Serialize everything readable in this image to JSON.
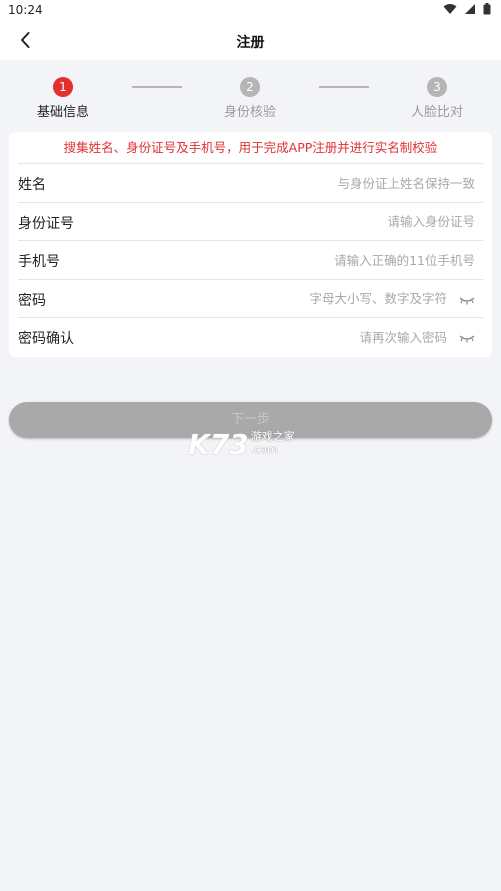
{
  "status_bar": {
    "time": "10:24"
  },
  "header": {
    "title": "注册"
  },
  "steps": [
    {
      "number": "1",
      "label": "基础信息",
      "active": true
    },
    {
      "number": "2",
      "label": "身份核验",
      "active": false
    },
    {
      "number": "3",
      "label": "人脸比对",
      "active": false
    }
  ],
  "form": {
    "notice": "搜集姓名、身份证号及手机号，用于完成APP注册并进行实名制校验",
    "fields": [
      {
        "label": "姓名",
        "placeholder": "与身份证上姓名保持一致",
        "value": ""
      },
      {
        "label": "身份证号",
        "placeholder": "请输入身份证号",
        "value": ""
      },
      {
        "label": "手机号",
        "placeholder": "请输入正确的11位手机号",
        "value": ""
      },
      {
        "label": "密码",
        "placeholder": "字母大小写、数字及字符",
        "value": ""
      },
      {
        "label": "密码确认",
        "placeholder": "请再次输入密码",
        "value": ""
      }
    ]
  },
  "next_button": {
    "label": "下一步",
    "enabled": false
  },
  "watermark": {
    "logo": "K73",
    "text1": "游戏之家",
    "text2": ".com"
  },
  "colors": {
    "accent": "#e0312f",
    "inactive_step": "#b5b5b5",
    "background": "#f3f4f8",
    "button_disabled": "#a9a9a9"
  },
  "icons": [
    "back-arrow-icon",
    "wifi-icon",
    "signal-icon",
    "battery-icon",
    "eye-closed-icon"
  ]
}
